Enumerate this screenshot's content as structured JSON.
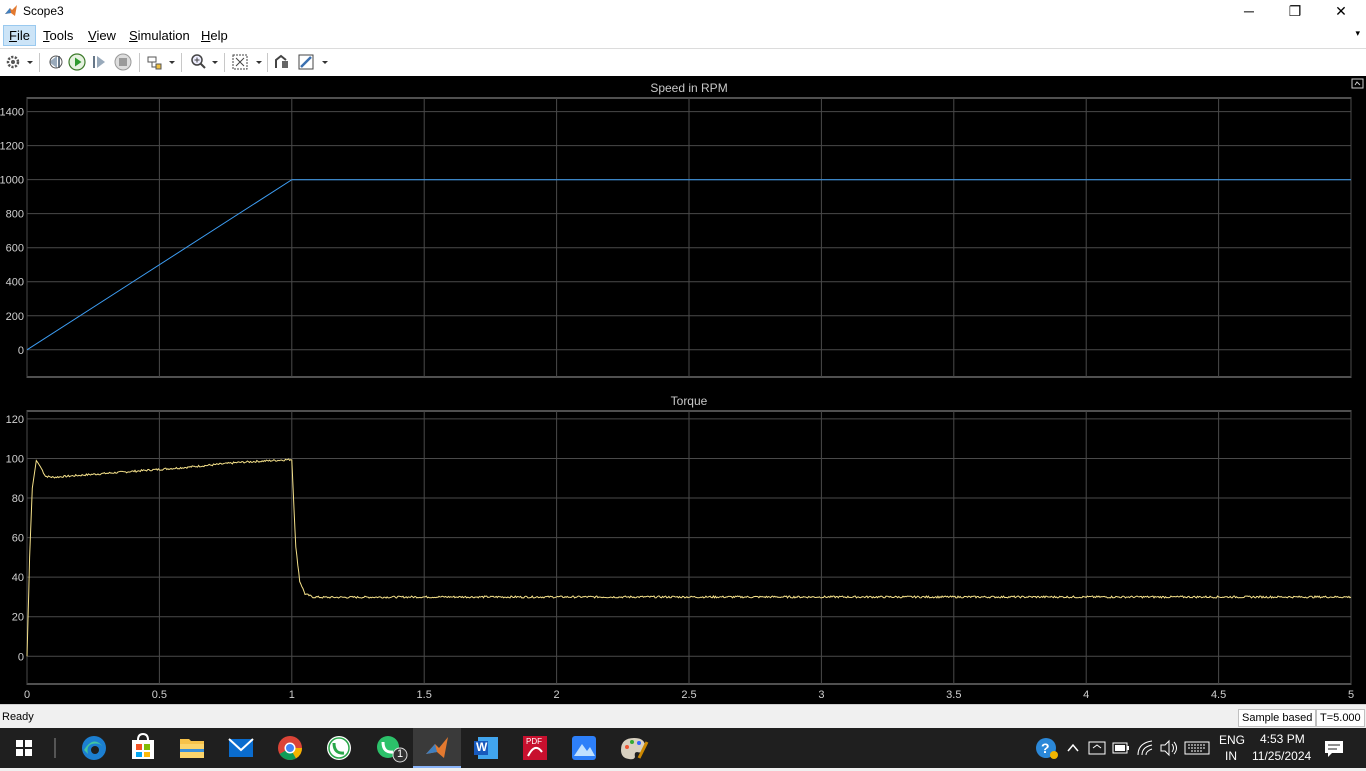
{
  "window": {
    "title": "Scope3",
    "minimize_glyph": "─",
    "maximize_glyph": "❐",
    "close_glyph": "✕"
  },
  "menu": {
    "items": [
      {
        "label": "File",
        "hotkey_index": 0
      },
      {
        "label": "Tools",
        "hotkey_index": 0
      },
      {
        "label": "View",
        "hotkey_index": 0
      },
      {
        "label": "Simulation",
        "hotkey_index": 0
      },
      {
        "label": "Help",
        "hotkey_index": 0
      }
    ],
    "collapse_glyph": "▾"
  },
  "toolbar": {
    "icons": [
      "settings-icon",
      "step-back-icon",
      "run-icon",
      "step-forward-icon",
      "stop-icon",
      "highlight-signal-icon",
      "zoom-icon",
      "autoscale-icon",
      "restore-layout-icon",
      "style-icon"
    ]
  },
  "plots": [
    {
      "title": "Speed in RPM",
      "ylim": [
        -160,
        1480
      ],
      "yticks": [
        0,
        200,
        400,
        600,
        800,
        1000,
        1200,
        1400
      ],
      "show_xtick_labels": false
    },
    {
      "title": "Torque",
      "ylim": [
        -14,
        124
      ],
      "yticks": [
        0,
        20,
        40,
        60,
        80,
        100,
        120
      ],
      "show_xtick_labels": true
    }
  ],
  "chart_data": [
    {
      "type": "line",
      "title": "Speed in RPM",
      "xlabel": "",
      "ylabel": "",
      "xlim": [
        0,
        5
      ],
      "ylim": [
        -160,
        1480
      ],
      "grid": true,
      "series": [
        {
          "color": "#3d9df3",
          "x": [
            0,
            1,
            5
          ],
          "y": [
            0,
            1000,
            1000
          ]
        }
      ]
    },
    {
      "type": "line",
      "title": "Torque",
      "xlabel": "",
      "ylabel": "",
      "xlim": [
        0,
        5
      ],
      "ylim": [
        -14,
        124
      ],
      "xticks": [
        "0",
        "0.5",
        "1",
        "1.5",
        "2",
        "2.5",
        "3",
        "3.5",
        "4",
        "4.5",
        "5"
      ],
      "grid": true,
      "series": [
        {
          "color": "#f5e18a",
          "x": [
            0,
            0.01,
            0.02,
            0.035,
            0.05,
            0.07,
            0.1,
            0.2,
            0.4,
            0.6,
            0.8,
            1.0,
            1.005,
            1.015,
            1.03,
            1.05,
            1.08,
            1.12,
            1.5,
            2,
            2.5,
            3,
            3.5,
            4,
            4.5,
            5
          ],
          "y": [
            0,
            50,
            85,
            99,
            96,
            91,
            90.5,
            91.5,
            93.5,
            95.5,
            98,
            99.5,
            85,
            55,
            38,
            31.5,
            30,
            29.8,
            30,
            30,
            30,
            30,
            30,
            30,
            30,
            30
          ]
        }
      ]
    }
  ],
  "status": {
    "ready": "Ready",
    "sample_based": "Sample based",
    "time": "T=5.000"
  },
  "taskbar": {
    "apps": [
      "edge-icon",
      "store-icon",
      "file-explorer-icon",
      "mail-icon",
      "chrome-icon",
      "whatsapp-icon",
      "whatsapp-notify-icon",
      "matlab-icon",
      "word-icon",
      "pdf-icon",
      "photos-icon",
      "paint-icon"
    ],
    "whatsapp_badge": "1",
    "pdf_label": "PDF",
    "word_letter": "W",
    "help_glyph": "?",
    "lang_top": "ENG",
    "lang_bottom": "IN",
    "time": "4:53 PM",
    "date": "11/25/2024"
  }
}
